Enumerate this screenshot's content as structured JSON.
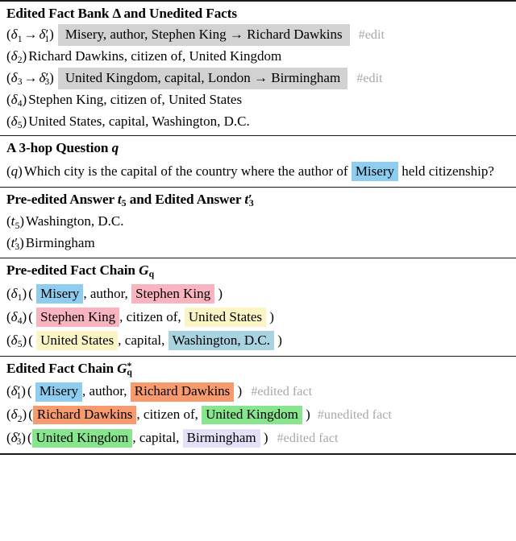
{
  "sections": {
    "fact_bank": {
      "heading": "Edited Fact Bank Δ and Unedited Facts",
      "rows": [
        {
          "label_open": "(",
          "label_sym": "δ",
          "label_sub": "1",
          "label_arrow": "→",
          "label_sym2": "δ",
          "label_sub2": "1",
          "label_prime": true,
          "label_close": ")",
          "text": "Misery, author, Stephen King → Richard Dawkins",
          "boxed": true,
          "tag": "#edit"
        },
        {
          "label_open": "(",
          "label_sym": "δ",
          "label_sub": "2",
          "label_close": ")",
          "text": "Richard Dawkins, citizen of, United Kingdom",
          "boxed": false,
          "tag": ""
        },
        {
          "label_open": "(",
          "label_sym": "δ",
          "label_sub": "3",
          "label_arrow": "→",
          "label_sym2": "δ",
          "label_sub2": "3",
          "label_prime": true,
          "label_close": ")",
          "text": "United Kingdom, capital, London → Birmingham",
          "boxed": true,
          "tag": "#edit"
        },
        {
          "label_open": "(",
          "label_sym": "δ",
          "label_sub": "4",
          "label_close": ")",
          "text": "Stephen King, citizen of, United States",
          "boxed": false,
          "tag": ""
        },
        {
          "label_open": "(",
          "label_sym": "δ",
          "label_sub": "5",
          "label_close": ")",
          "text": "United States, capital, Washington, D.C.",
          "boxed": false,
          "tag": ""
        }
      ]
    },
    "question": {
      "heading_text": "A 3-hop Question ",
      "heading_sym": "q",
      "label_open": "(",
      "label_sym": "q",
      "label_close": ")",
      "text_before": "Which city is the capital of the country where the author of",
      "highlight": "Misery",
      "text_after": "held citizenship?"
    },
    "answers": {
      "heading_a": "Pre-edited Answer ",
      "heading_t1": "t",
      "heading_t1_sub": "5",
      "heading_b": " and Edited Answer ",
      "heading_t2": "t",
      "heading_t2_sub": "3",
      "rows": [
        {
          "sym": "t",
          "sub": "5",
          "prime": false,
          "text": "Washington, D.C."
        },
        {
          "sym": "t",
          "sub": "3",
          "prime": true,
          "text": "Birmingham"
        }
      ]
    },
    "pre_chain": {
      "heading_text": "Pre-edited Fact Chain ",
      "heading_sym": "G",
      "heading_sub": "q",
      "rows": [
        {
          "sym": "δ",
          "sub": "1",
          "prime": false,
          "subject": "Misery",
          "subject_color": "hl-blue",
          "relation": ", author,",
          "object": "Stephen King",
          "object_color": "hl-pink",
          "tag": ""
        },
        {
          "sym": "δ",
          "sub": "4",
          "prime": false,
          "subject": "Stephen King",
          "subject_color": "hl-pink",
          "relation": ", citizen of,",
          "object": "United States",
          "object_color": "hl-yellow",
          "tag": ""
        },
        {
          "sym": "δ",
          "sub": "5",
          "prime": false,
          "subject": "United States",
          "subject_color": "hl-yellow",
          "relation": ", capital,",
          "object": "Washington, D.C.",
          "object_color": "hl-steelblue",
          "tag": ""
        }
      ]
    },
    "edited_chain": {
      "heading_text": "Edited Fact Chain ",
      "heading_sym": "G",
      "heading_sub": "q",
      "heading_sup": "*",
      "rows": [
        {
          "sym": "δ",
          "sub": "1",
          "prime": true,
          "subject": "Misery",
          "subject_color": "hl-blue",
          "relation": ", author,",
          "object": "Richard Dawkins",
          "object_color": "hl-orange",
          "tag": "#edited fact"
        },
        {
          "sym": "δ",
          "sub": "2",
          "prime": false,
          "subject": "Richard Dawkins",
          "subject_color": "hl-orange",
          "relation": ", citizen of,",
          "object": "United Kingdom",
          "object_color": "hl-green",
          "tag": "#unedited fact"
        },
        {
          "sym": "δ",
          "sub": "3",
          "prime": true,
          "subject": "United Kingdom",
          "subject_color": "hl-green",
          "relation": ", capital,",
          "object": "Birmingham",
          "object_color": "hl-lavender",
          "tag": "#edited fact"
        }
      ]
    }
  },
  "palette": {
    "blue": "#8ecdf0",
    "pink": "#f9b4c0",
    "yellow": "#fbf4c4",
    "steelblue": "#a9d3e0",
    "orange": "#f79a6e",
    "green": "#87e58e",
    "lavender": "#e2e1f7",
    "edit_gray": "#d2d2d2",
    "tag_gray": "#a8a8a8",
    "rule": "#1a1a1a"
  },
  "paren": {
    "open": "(",
    "close": ")"
  }
}
